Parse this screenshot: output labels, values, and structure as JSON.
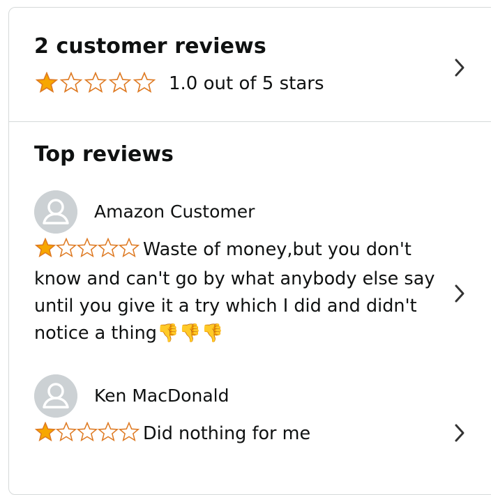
{
  "summary": {
    "title": "2 customer reviews",
    "rating_value": 1.0,
    "rating_text": "1.0 out of 5 stars"
  },
  "top_reviews": {
    "title": "Top reviews",
    "reviews": [
      {
        "reviewer": "Amazon Customer",
        "rating": 1,
        "text": "Waste of money,but you don't know and can't go by what anybody else say until you give it a try which I did and didn't notice a thing",
        "emoji": "👎👎👎"
      },
      {
        "reviewer": "Ken MacDonald",
        "rating": 1,
        "text": "Did nothing for me",
        "emoji": ""
      }
    ]
  },
  "colors": {
    "star_filled": "#f7a700",
    "star_outline": "#de7921",
    "border": "#d5d9d9",
    "avatar_bg": "#ccd1d4",
    "text": "#0f1111"
  },
  "icons": {
    "star_filled": "star-filled-icon",
    "star_empty": "star-empty-icon",
    "chevron": "chevron-right-icon",
    "avatar": "user-avatar-icon"
  }
}
